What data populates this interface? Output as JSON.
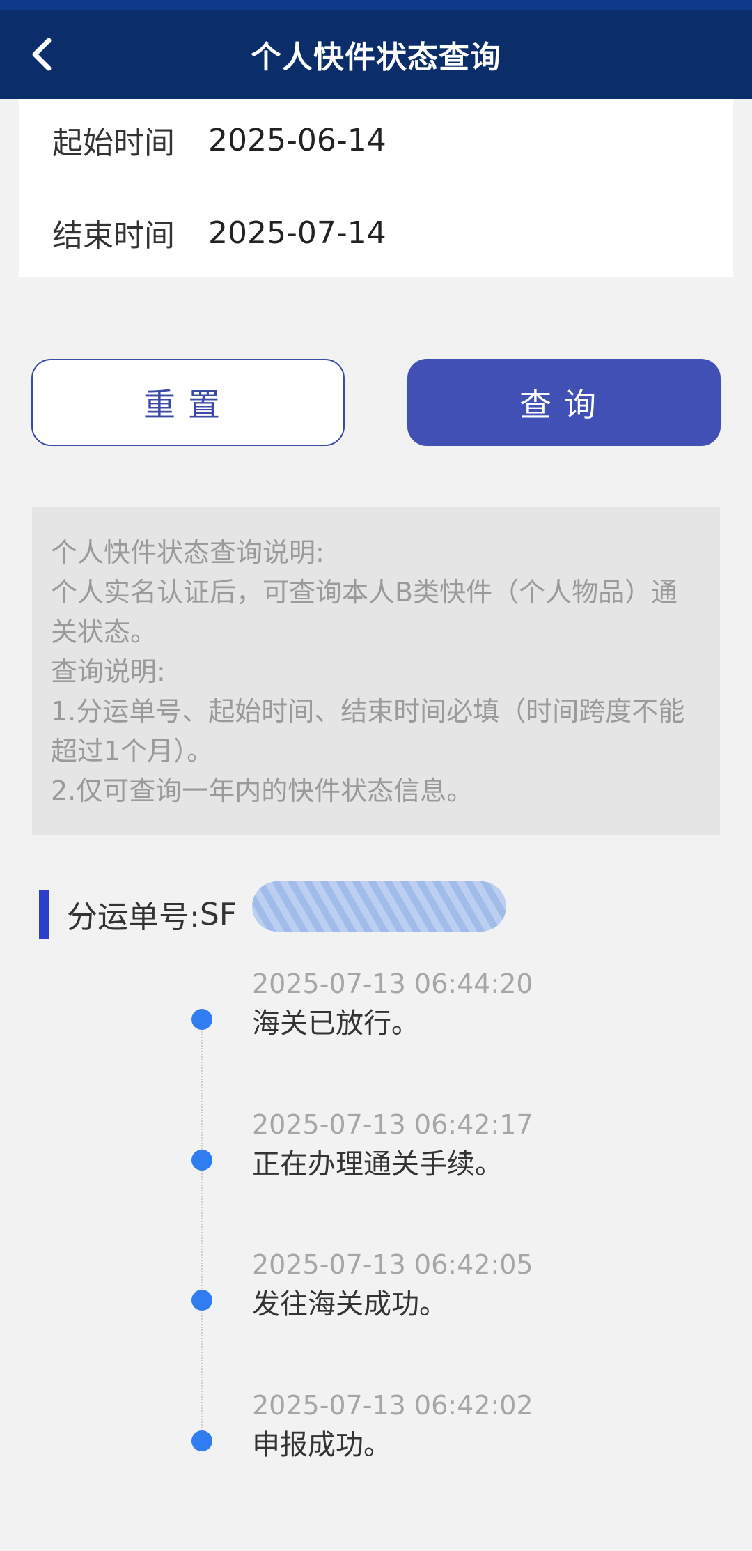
{
  "header": {
    "title": "个人快件状态查询"
  },
  "dates": {
    "start_label": "起始时间",
    "start_value": "2025-06-14",
    "end_label": "结束时间",
    "end_value": "2025-07-14"
  },
  "buttons": {
    "reset": "重置",
    "query": "查询"
  },
  "notice": {
    "lines": [
      "个人快件状态查询说明:",
      "个人实名认证后，可查询本人B类快件（个人物品）通关状态。",
      "查询说明:",
      "1.分运单号、起始时间、结束时间必填（时间跨度不能超过1个月）。",
      "2.仅可查询一年内的快件状态信息。"
    ]
  },
  "waybill": {
    "label": "分运单号:",
    "number_visible": "SF"
  },
  "timeline": [
    {
      "time": "2025-07-13 06:44:20",
      "text": "海关已放行。"
    },
    {
      "time": "2025-07-13 06:42:17",
      "text": "正在办理通关手续。"
    },
    {
      "time": "2025-07-13 06:42:05",
      "text": "发往海关成功。"
    },
    {
      "time": "2025-07-13 06:42:02",
      "text": "申报成功。"
    }
  ],
  "colors": {
    "header_bg": "#0b2e6b",
    "primary": "#4050b5",
    "dot": "#2f7df0"
  }
}
